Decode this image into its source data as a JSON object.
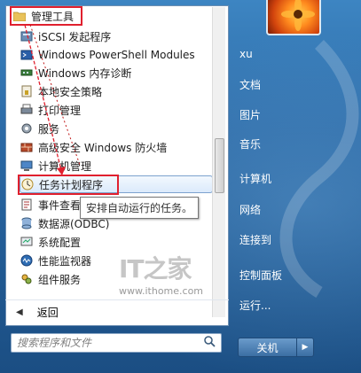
{
  "programs": {
    "folder_label": "管理工具",
    "items": [
      {
        "label": "iSCSI 发起程序",
        "icon": "iscsi-icon"
      },
      {
        "label": "Windows PowerShell Modules",
        "icon": "powershell-icon"
      },
      {
        "label": "Windows 内存诊断",
        "icon": "memory-diagnostic-icon"
      },
      {
        "label": "本地安全策略",
        "icon": "security-policy-icon"
      },
      {
        "label": "打印管理",
        "icon": "printer-icon"
      },
      {
        "label": "服务",
        "icon": "services-icon"
      },
      {
        "label": "高级安全 Windows 防火墙",
        "icon": "firewall-icon"
      },
      {
        "label": "计算机管理",
        "icon": "computer-management-icon"
      },
      {
        "label": "任务计划程序",
        "icon": "clock-icon"
      },
      {
        "label": "事件查看",
        "icon": "event-viewer-icon"
      },
      {
        "label": "数据源(ODBC)",
        "icon": "odbc-icon"
      },
      {
        "label": "系统配置",
        "icon": "system-config-icon"
      },
      {
        "label": "性能监视器",
        "icon": "performance-monitor-icon"
      },
      {
        "label": "组件服务",
        "icon": "component-services-icon"
      }
    ],
    "selected_label": "任务计划程序",
    "tooltip": "安排自动运行的任务。"
  },
  "back_label": "返回",
  "search": {
    "placeholder": "搜索程序和文件"
  },
  "right_menu": {
    "user": "xu",
    "items": [
      "文档",
      "图片",
      "音乐",
      "计算机",
      "网络",
      "连接到",
      "控制面板",
      "运行..."
    ]
  },
  "shutdown": {
    "label": "关机"
  },
  "watermark": {
    "logo": "IT之家",
    "url": "www.ithome.com"
  },
  "colors": {
    "highlight": "#e0202e",
    "panel": "#2c6aa6"
  }
}
